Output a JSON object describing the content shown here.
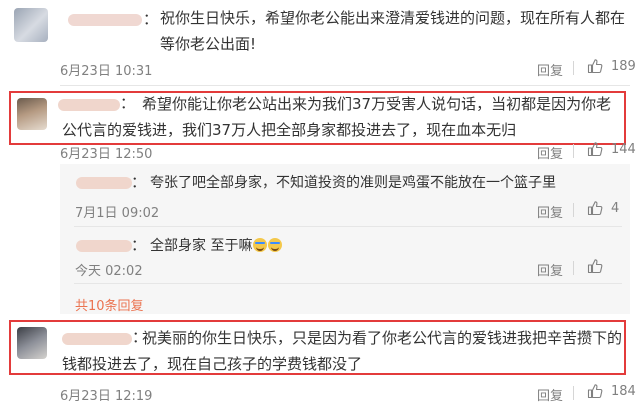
{
  "comments": [
    {
      "text": "祝你生日快乐，希望你老公能出来澄清爱钱进的问题，现在所有人都在等你老公出面!",
      "time": "6月23日 10:31",
      "reply_label": "回复",
      "likes": "189"
    },
    {
      "text": "希望你能让你老公站出来为我们37万受害人说句话，当初都是因为你老公代言的爱钱进，我们37万人把全部身家都投进去了，现在血本无归",
      "time": "6月23日 12:50",
      "reply_label": "回复",
      "likes": "144"
    },
    {
      "text": "祝美丽的你生日快乐，只是因为看了你老公代言的爱钱进我把辛苦攒下的钱都投进去了，现在自己孩子的学费钱都没了",
      "time": "6月23日 12:19",
      "reply_label": "回复",
      "likes": "184"
    }
  ],
  "replies": [
    {
      "text": "夸张了吧全部身家，不知道投资的准则是鸡蛋不能放在一个篮子里",
      "time": "7月1日 09:02",
      "reply_label": "回复",
      "likes": "4"
    },
    {
      "text": "全部身家 至于嘛",
      "time": "今天 02:02",
      "reply_label": "回复",
      "likes": ""
    }
  ],
  "more_replies": "共10条回复",
  "colors": {
    "highlight": "#e33b3b",
    "link": "#eb7350",
    "muted": "#808080"
  },
  "icons": [
    "thumbs-up-icon",
    "laugh-cry-emoji"
  ]
}
